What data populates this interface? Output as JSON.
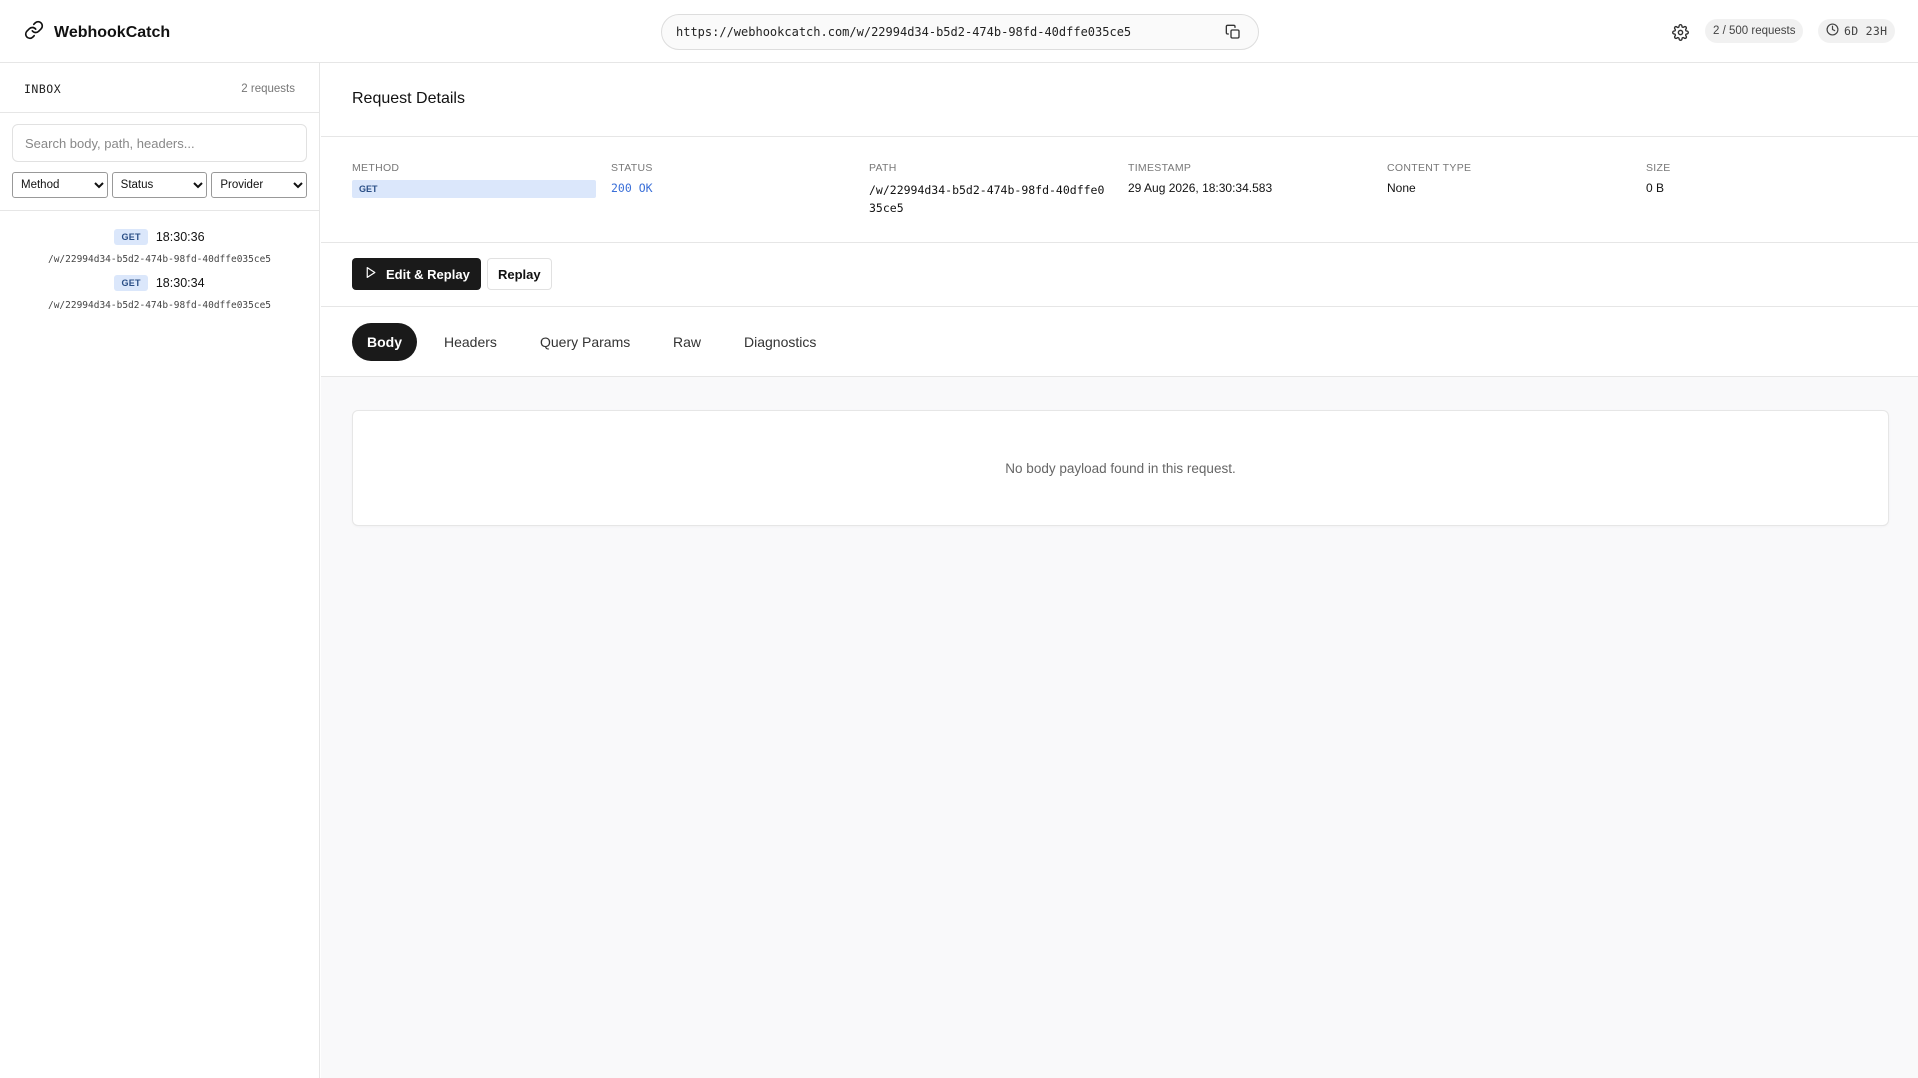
{
  "app": {
    "name": "WebhookCatch"
  },
  "urlbar": {
    "url": "https://webhookcatch.com/w/22994d34-b5d2-474b-98fd-40dffe035ce5"
  },
  "header": {
    "request_usage": "2 / 500 requests",
    "time_left": "6D 23H"
  },
  "sidebar": {
    "title": "INBOX",
    "count": "2 requests",
    "search_placeholder": "Search body, path, headers...",
    "filters": {
      "method": "Method",
      "status": "Status",
      "provider": "Provider"
    },
    "requests": [
      {
        "method": "GET",
        "time": "18:30:36",
        "path": "/w/22994d34-b5d2-474b-98fd-40dffe035ce5"
      },
      {
        "method": "GET",
        "time": "18:30:34",
        "path": "/w/22994d34-b5d2-474b-98fd-40dffe035ce5"
      }
    ]
  },
  "details": {
    "title": "Request Details",
    "labels": {
      "method": "METHOD",
      "status": "STATUS",
      "path": "PATH",
      "timestamp": "TIMESTAMP",
      "content_type": "CONTENT TYPE",
      "size": "SIZE"
    },
    "values": {
      "method": "GET",
      "status": "200 OK",
      "path": "/w/22994d34-b5d2-474b-98fd-40dffe035ce5",
      "timestamp": "29 Aug 2026, 18:30:34.583",
      "content_type": "None",
      "size": "0 B"
    }
  },
  "actions": {
    "edit_replay": "Edit & Replay",
    "replay": "Replay"
  },
  "tabs": [
    "Body",
    "Headers",
    "Query Params",
    "Raw",
    "Diagnostics"
  ],
  "active_tab": "Body",
  "body": {
    "empty_message": "No body payload found in this request."
  },
  "colors": {
    "accent_dark": "#1a1a1a",
    "method_badge_bg": "#dbe7fb",
    "method_badge_fg": "#2b4f86",
    "status_ok": "#3a6fd8"
  }
}
